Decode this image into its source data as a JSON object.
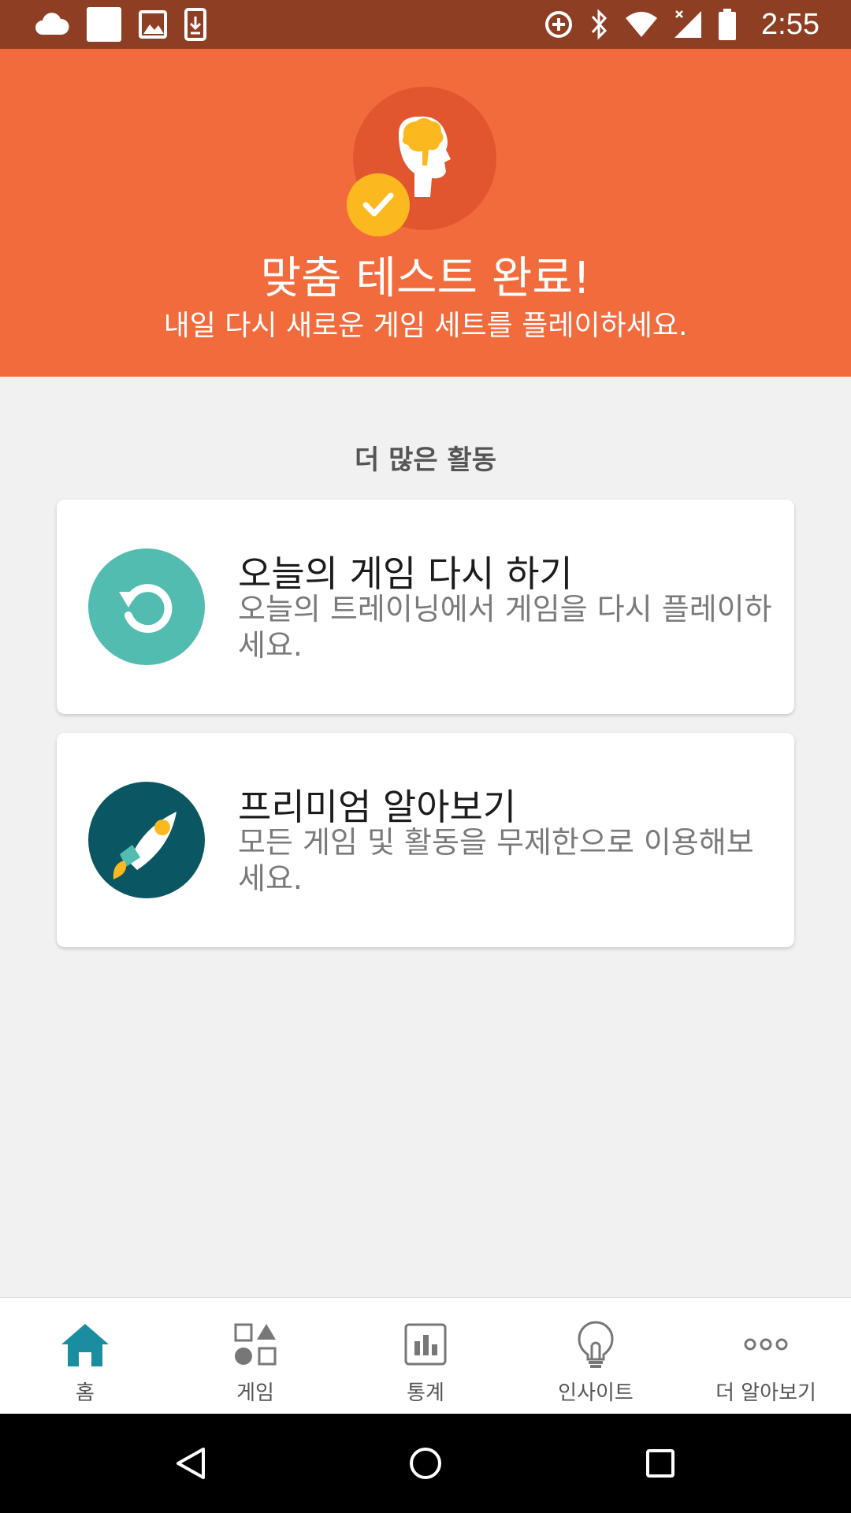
{
  "status_bar": {
    "time": "2:55",
    "left_icons": [
      "cloud-icon",
      "blank-square-icon",
      "image-icon",
      "download-icon"
    ],
    "right_icons": [
      "data-saver-icon",
      "bluetooth-icon",
      "wifi-icon",
      "signal-icon",
      "battery-icon"
    ]
  },
  "header": {
    "title": "맞춤 테스트 완료!",
    "subtitle": "내일 다시 새로운 게임 세트를 플레이하세요.",
    "bg_color": "#f26b3d",
    "badge_color": "#fcb91f"
  },
  "section": {
    "label": "더 많은 활동"
  },
  "cards": [
    {
      "title": "오늘의 게임 다시 하기",
      "description": "오늘의 트레이닝에서 게임을 다시 플레이하세요.",
      "icon": "replay-icon",
      "icon_color": "#52bcb1"
    },
    {
      "title": "프리미엄 알아보기",
      "description": "모든 게임 및 활동을 무제한으로 이용해보세요.",
      "icon": "rocket-icon",
      "icon_color": "#0b5663"
    }
  ],
  "bottom_nav": {
    "items": [
      {
        "label": "홈",
        "icon": "home-icon",
        "active": true
      },
      {
        "label": "게임",
        "icon": "games-icon",
        "active": false
      },
      {
        "label": "통계",
        "icon": "stats-icon",
        "active": false
      },
      {
        "label": "인사이트",
        "icon": "lightbulb-icon",
        "active": false
      },
      {
        "label": "더 알아보기",
        "icon": "more-icon",
        "active": false
      }
    ],
    "active_color": "#1a8ea0"
  },
  "system_nav": [
    "back-icon",
    "home-circle-icon",
    "recents-icon"
  ]
}
